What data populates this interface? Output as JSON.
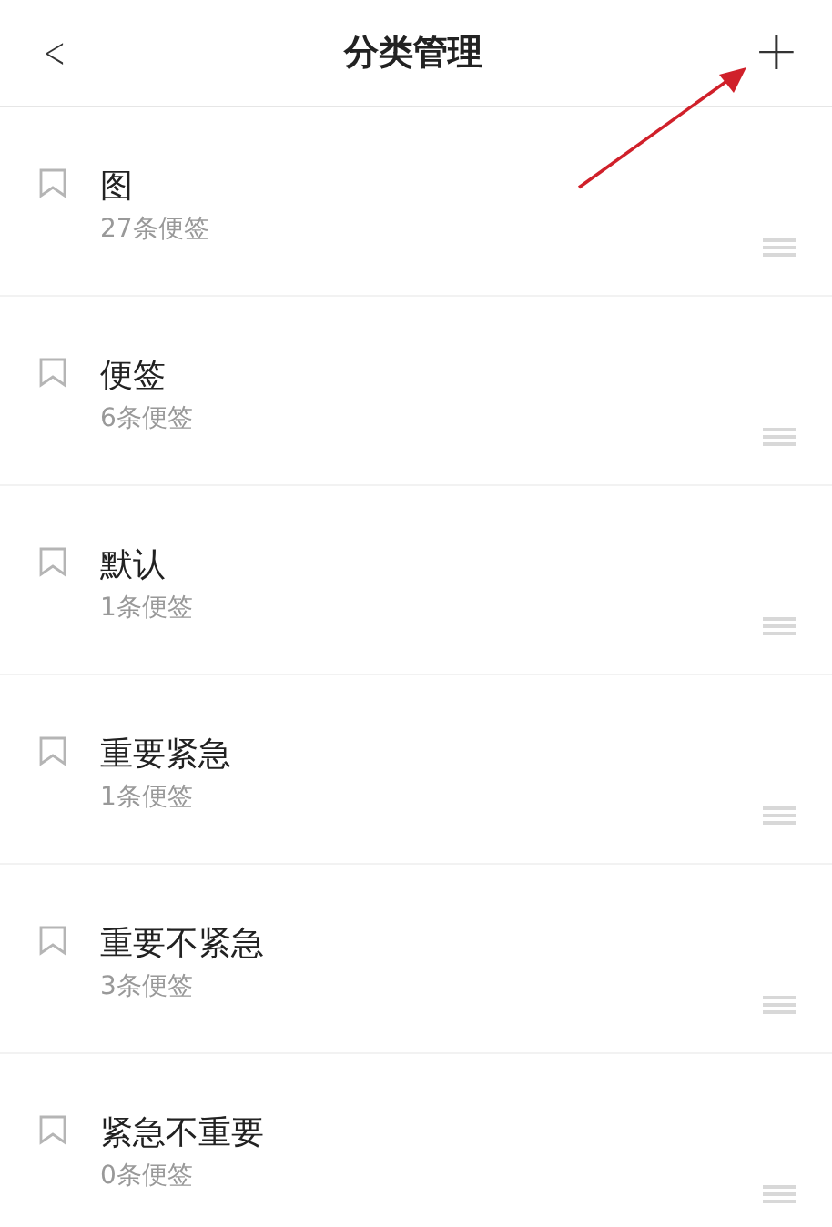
{
  "header": {
    "back": "<",
    "title": "分类管理",
    "add": "+"
  },
  "categories": [
    {
      "name": "图",
      "count": "27条便签"
    },
    {
      "name": "便签",
      "count": "6条便签"
    },
    {
      "name": "默认",
      "count": "1条便签"
    },
    {
      "name": "重要紧急",
      "count": "1条便签"
    },
    {
      "name": "重要不紧急",
      "count": "3条便签"
    },
    {
      "name": "紧急不重要",
      "count": "0条便签"
    }
  ]
}
